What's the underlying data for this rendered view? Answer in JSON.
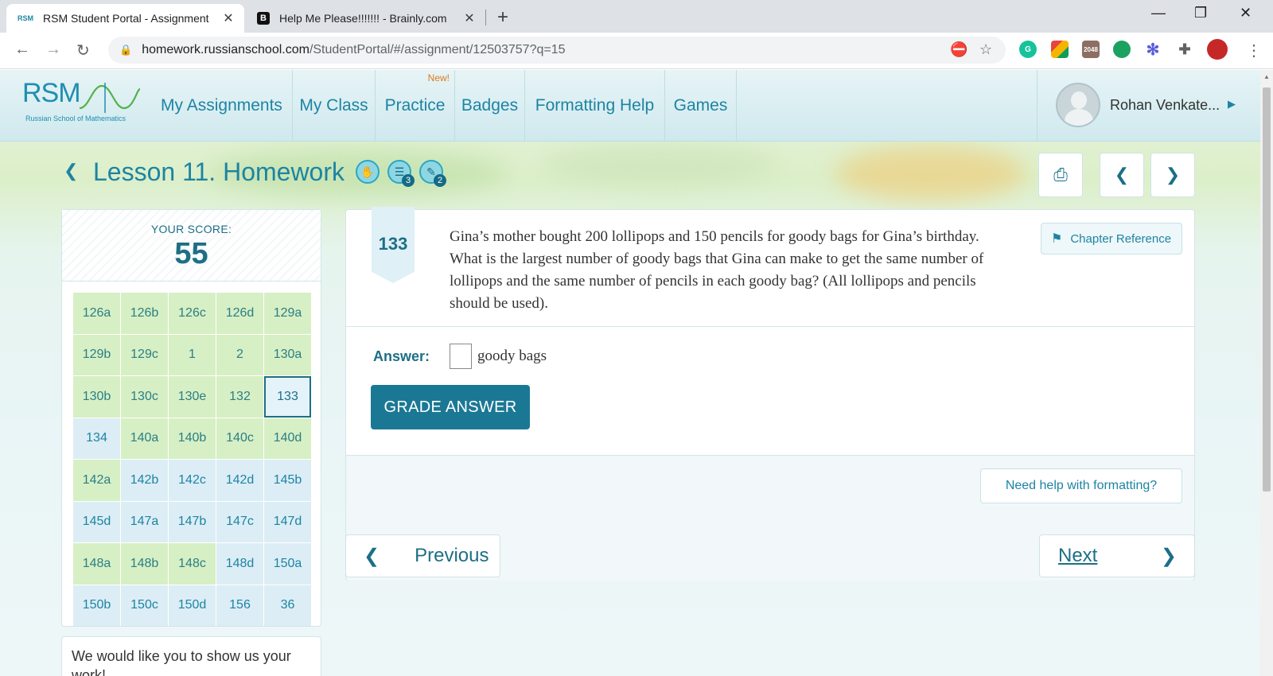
{
  "browser": {
    "tabs": [
      {
        "favicon": "RSM",
        "title": "RSM Student Portal - Assignment",
        "active": true
      },
      {
        "favicon": "B",
        "title": "Help Me Please!!!!!!! - Brainly.com",
        "active": false
      }
    ],
    "url_host": "homework.russianschool.com",
    "url_path": "/StudentPortal/#/assignment/12503757?q=15",
    "extensions": [
      "grammarly-icon",
      "palette-icon",
      "2048-icon",
      "chat-icon",
      "snowflake-icon",
      "puzzle-icon",
      "profile-icon"
    ],
    "ext_2048_label": "2048"
  },
  "header": {
    "logo_text": "RSM",
    "logo_subtitle": "Russian School of Mathematics",
    "nav": [
      "My Assignments",
      "My Class",
      "Practice",
      "Badges",
      "Formatting Help",
      "Games"
    ],
    "practice_badge": "New!",
    "user_name": "Rohan Venkate..."
  },
  "lesson": {
    "title": "Lesson 11. Homework",
    "tool_counts": {
      "workbook": "3",
      "tools": "2"
    }
  },
  "score": {
    "label": "YOUR SCORE:",
    "value": "55"
  },
  "problems": [
    {
      "id": "126a",
      "state": "g"
    },
    {
      "id": "126b",
      "state": "g"
    },
    {
      "id": "126c",
      "state": "g"
    },
    {
      "id": "126d",
      "state": "g"
    },
    {
      "id": "129a",
      "state": "g"
    },
    {
      "id": "129b",
      "state": "g"
    },
    {
      "id": "129c",
      "state": "g"
    },
    {
      "id": "1",
      "state": "g"
    },
    {
      "id": "2",
      "state": "g"
    },
    {
      "id": "130a",
      "state": "g"
    },
    {
      "id": "130b",
      "state": "g"
    },
    {
      "id": "130c",
      "state": "g"
    },
    {
      "id": "130e",
      "state": "g"
    },
    {
      "id": "132",
      "state": "g"
    },
    {
      "id": "133",
      "state": "cur"
    },
    {
      "id": "134",
      "state": "b"
    },
    {
      "id": "140a",
      "state": "g"
    },
    {
      "id": "140b",
      "state": "g"
    },
    {
      "id": "140c",
      "state": "g"
    },
    {
      "id": "140d",
      "state": "g"
    },
    {
      "id": "142a",
      "state": "g"
    },
    {
      "id": "142b",
      "state": "b"
    },
    {
      "id": "142c",
      "state": "b"
    },
    {
      "id": "142d",
      "state": "b"
    },
    {
      "id": "145b",
      "state": "b"
    },
    {
      "id": "145d",
      "state": "b"
    },
    {
      "id": "147a",
      "state": "b"
    },
    {
      "id": "147b",
      "state": "b"
    },
    {
      "id": "147c",
      "state": "b"
    },
    {
      "id": "147d",
      "state": "b"
    },
    {
      "id": "148a",
      "state": "g"
    },
    {
      "id": "148b",
      "state": "g"
    },
    {
      "id": "148c",
      "state": "g"
    },
    {
      "id": "148d",
      "state": "b"
    },
    {
      "id": "150a",
      "state": "b"
    },
    {
      "id": "150b",
      "state": "b"
    },
    {
      "id": "150c",
      "state": "b"
    },
    {
      "id": "150d",
      "state": "b"
    },
    {
      "id": "156",
      "state": "b"
    },
    {
      "id": "36",
      "state": "b"
    }
  ],
  "show_work_text": "We would like you to show us your work!",
  "question": {
    "number": "133",
    "text": "Gina’s mother bought 200 lollipops and 150 pencils for goody bags for Gina’s birthday. What is the largest number of goody bags that Gina can make to get the same number of lollipops and the same number of pencils in each goody bag? (All lollipops and pencils should be used).",
    "chapter_reference": "Chapter Reference",
    "answer_label": "Answer:",
    "answer_value": "",
    "answer_unit": "goody bags",
    "grade_button": "GRADE ANSWER",
    "formatting_help": "Need help with formatting?"
  },
  "pager": {
    "previous": "Previous",
    "next": "Next"
  },
  "colors": {
    "primary": "#1d6f86",
    "link": "#1d84a3",
    "grade_button": "#1b7895",
    "answered_cell": "#d7efc4",
    "unanswered_cell": "#dcedf5",
    "new_badge": "#e07a1e"
  }
}
